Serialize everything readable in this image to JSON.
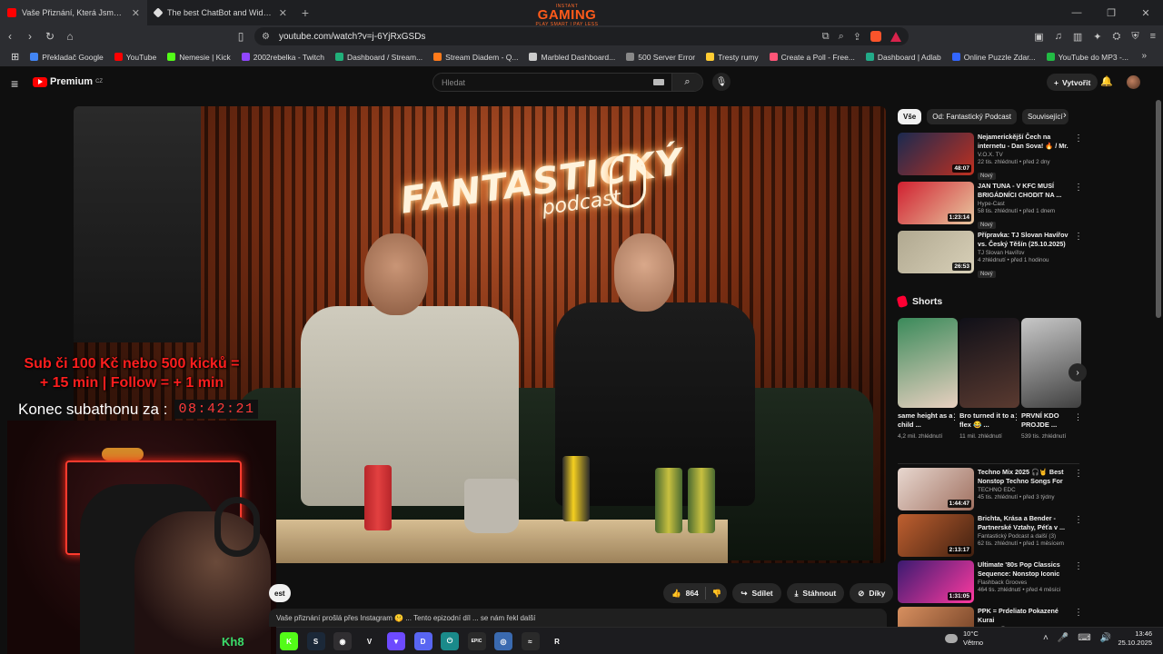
{
  "browser": {
    "tabs": [
      {
        "title": "Vaše Přiznání, Která Jsme Nemě",
        "favicon_color": "#ff0000",
        "active": true
      },
      {
        "title": "The best ChatBot and Widgets for Ki",
        "favicon_color": "#dddddd",
        "active": false
      }
    ],
    "new_tab_label": "+",
    "gaming_logo": {
      "top": "INSTANT",
      "main": "GAMING",
      "sub": "PLAY SMART | PAY LESS"
    },
    "window_controls": {
      "minimize": "—",
      "maximize": "❐",
      "close": "✕"
    },
    "url": "youtube.com/watch?v=j-6YjRxGSDs",
    "bookmarks": [
      {
        "label": "Překladač Google",
        "color": "#4285f4"
      },
      {
        "label": "YouTube",
        "color": "#ff0000"
      },
      {
        "label": "Nemesie | Kick",
        "color": "#53fc18"
      },
      {
        "label": "2002rebelka - Twitch",
        "color": "#9146ff"
      },
      {
        "label": "Dashboard / Stream...",
        "color": "#21b07a"
      },
      {
        "label": "Stream Diadem - Q...",
        "color": "#ff7a1a"
      },
      {
        "label": "Marbled Dashboard...",
        "color": "#cccccc"
      },
      {
        "label": "500 Server Error",
        "color": "#888888"
      },
      {
        "label": "Tresty rumy",
        "color": "#ffcc33"
      },
      {
        "label": "Create a Poll - Free...",
        "color": "#ff5577"
      },
      {
        "label": "Dashboard | Adlab",
        "color": "#22aa88"
      },
      {
        "label": "Online Puzzle Zdar...",
        "color": "#3366ff"
      },
      {
        "label": "YouTube do MP3 -...",
        "color": "#22bb44"
      }
    ],
    "bookmarks_more": "»"
  },
  "youtube": {
    "logo_text": "Premium",
    "logo_region": "CZ",
    "search_placeholder": "Hledat",
    "create_label": "Vytvořit",
    "stream_overlay": {
      "promo_line1": "Sub či 100 Kč nebo 500 kicků =",
      "promo_line2": "+ 15 min | Follow = + 1 min",
      "countdown_label": "Konec subathonu za :",
      "countdown_value": "08:42:21"
    },
    "video_neon": {
      "line1": "FANTASTICKÝ",
      "line2": "podcast"
    },
    "subscribe_chip": "est",
    "description_snippet": "Vaše přiznání prošlá přes Instagram 🤫 ... Tento epizodní díl ... se nám řekl další",
    "actions": {
      "likes": "864",
      "share": "Sdílet",
      "download": "Stáhnout",
      "thanks": "Díky"
    },
    "sidebar_chips": [
      "Vše",
      "Od: Fantastický Podcast",
      "Související"
    ],
    "related": [
      {
        "title": "Nejamerickější Čech na internetu - Dan Sova! 🔥 / Mr. ...",
        "channel": "V.O.X. TV",
        "stats": "22 tis. zhlédnutí • před 2 dny",
        "badge": "Nový",
        "duration": "48:07",
        "thumb_a": "#1a2a50",
        "thumb_b": "#c03020"
      },
      {
        "title": "JAN TUNA - V KFC MUSÍ BRIGÁDNÍCI CHODIT NA ...",
        "channel": "Hype-Cast",
        "stats": "58 tis. zhlédnutí • před 1 dnem",
        "badge": "Nový",
        "duration": "1:23:14",
        "thumb_a": "#d02030",
        "thumb_b": "#e8c8a0"
      },
      {
        "title": "Přípravka: TJ Slovan Havířov vs. Český Těšín (25.10.2025)",
        "channel": "TJ Slovan Havířov",
        "stats": "4 zhlédnutí • před 1 hodinou",
        "badge": "Nový",
        "duration": "26:53",
        "thumb_a": "#b0a890",
        "thumb_b": "#d8d0b8"
      }
    ],
    "shorts_title": "Shorts",
    "shorts": [
      {
        "title": "same height as a child ...",
        "views": "4,2 mil. zhlédnutí",
        "thumb_a": "#3a8a5a",
        "thumb_b": "#e8d0c0"
      },
      {
        "title": "Bro turned it to a flex 😂 ...",
        "views": "11 mil. zhlédnutí",
        "thumb_a": "#101018",
        "thumb_b": "#5a3a30"
      },
      {
        "title": "PRVNÍ KDO PROJDE ...",
        "views": "539 tis. zhlédnutí",
        "thumb_a": "#c8c8c8",
        "thumb_b": "#404040"
      }
    ],
    "related2": [
      {
        "title": "Techno Mix 2025 🎧🤘 Best Nonstop Techno Songs For ...",
        "channel": "TECHNO EDC",
        "stats": "45 tis. zhlédnutí • před 3 týdny",
        "duration": "1:44:47",
        "thumb_a": "#e8d8d0",
        "thumb_b": "#a07060"
      },
      {
        "title": "Brichta, Krása a Bender - Partnerské Vztahy, Péťa v ...",
        "channel": "Fantastický Podcast a další (3)",
        "stats": "62 tis. zhlédnutí • před 1 měsícem",
        "duration": "2:13:17",
        "thumb_a": "#c06030",
        "thumb_b": "#402010"
      },
      {
        "title": "Ultimate '80s Pop Classics Sequence: Nonstop Iconic Hits",
        "channel": "Flashback Grooves",
        "stats": "464 tis. zhlédnutí • před 4 měsíci",
        "duration": "1:31:05",
        "thumb_a": "#3a1a70",
        "thumb_b": "#ff3aa0"
      },
      {
        "title": "PPK = Prdeliato Pokazené Kurai",
        "channel": "Duklock 🔘",
        "stats": "",
        "duration": "",
        "thumb_a": "#d89060",
        "thumb_b": "#6a3a20"
      }
    ]
  },
  "taskbar": {
    "overlay_text": "Kh8",
    "weather_temp": "10°C",
    "weather_desc": "Větrno",
    "time": "13:46",
    "date": "25.10.2025",
    "icons": [
      {
        "name": "kick-taskbar-icon",
        "color": "#53fc18",
        "glyph": "K"
      },
      {
        "name": "steam-taskbar-icon",
        "color": "#1b2838",
        "glyph": "S"
      },
      {
        "name": "obs-taskbar-icon",
        "color": "#302e31",
        "glyph": "◉"
      },
      {
        "name": "valorant-taskbar-icon",
        "color": "#1c1c1f",
        "glyph": "V"
      },
      {
        "name": "proton-taskbar-icon",
        "color": "#6d4aff",
        "glyph": "▼"
      },
      {
        "name": "discord-taskbar-icon",
        "color": "#5865f2",
        "glyph": "D"
      },
      {
        "name": "power-taskbar-icon",
        "color": "#1a8a8a",
        "glyph": "⏻"
      },
      {
        "name": "epic-taskbar-icon",
        "color": "#2a2a2a",
        "glyph": "EPIC"
      },
      {
        "name": "app-taskbar-icon",
        "color": "#3a6ab0",
        "glyph": "◎"
      },
      {
        "name": "stream-taskbar-icon",
        "color": "#2a2a2a",
        "glyph": "≈"
      },
      {
        "name": "riot-taskbar-icon",
        "color": "#1c1c1f",
        "glyph": "R"
      }
    ]
  }
}
